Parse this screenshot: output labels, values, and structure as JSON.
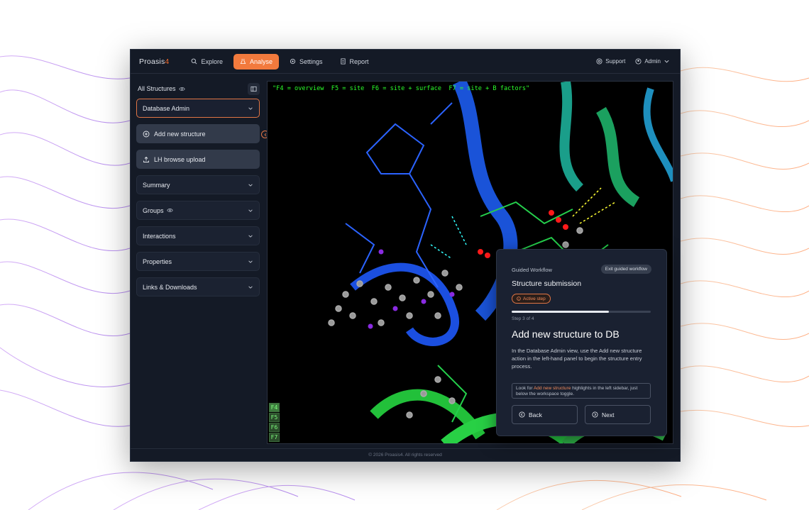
{
  "app": {
    "brand_name": "Proasis",
    "brand_version": "4",
    "accent_color": "#f27a3d"
  },
  "nav": [
    {
      "label": "Explore",
      "icon": "search-icon",
      "active": false
    },
    {
      "label": "Analyse",
      "icon": "flask-icon",
      "active": true
    },
    {
      "label": "Settings",
      "icon": "gear-icon",
      "active": false
    },
    {
      "label": "Report",
      "icon": "document-icon",
      "active": false
    }
  ],
  "top_right": {
    "support_label": "Support",
    "user_label": "Admin"
  },
  "sidebar": {
    "title": "All Structures",
    "selected_view": "Database Admin",
    "actions": [
      {
        "label": "Add new structure",
        "icon": "plus-circle-icon"
      },
      {
        "label": "LH browse upload",
        "icon": "upload-icon"
      }
    ],
    "sections": [
      {
        "label": "Summary",
        "has_eye": false
      },
      {
        "label": "Groups",
        "has_eye": true
      },
      {
        "label": "Interactions",
        "has_eye": false
      },
      {
        "label": "Properties",
        "has_eye": false
      },
      {
        "label": "Links & Downloads",
        "has_eye": false
      }
    ]
  },
  "viewer": {
    "overlay_text": "\"F4 = overview  F5 = site  F6 = site + surface  F7 = site + B factors\"",
    "fkeys": [
      "F4",
      "F5",
      "F6",
      "F7"
    ]
  },
  "guided_workflow": {
    "label": "Guided Workflow",
    "exit_label": "Exit guided workflow",
    "title": "Structure submission",
    "badge": "Active step",
    "progress": 0.7,
    "step_text": "Step 3 of 4",
    "heading": "Add new structure to DB",
    "description": "In the Database Admin view, use the Add new structure action in the left-hand panel to begin the structure entry process.",
    "hint_prefix": "Look for ",
    "hint_highlight": "Add new structure",
    "hint_suffix": " highlights in the left sidebar, just below the workspace toggle.",
    "back_label": "Back",
    "next_label": "Next"
  },
  "footer": {
    "text": "© 2026 Proasis4. All rights reserved"
  }
}
